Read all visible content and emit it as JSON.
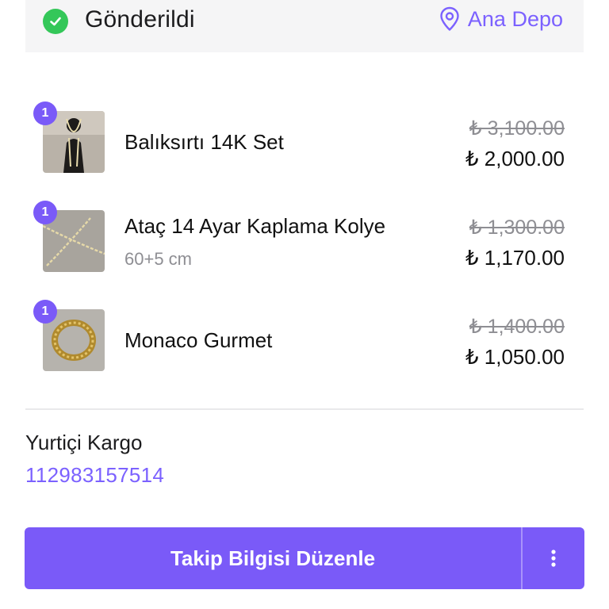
{
  "header": {
    "status_label": "Gönderildi",
    "status_color": "#34c759",
    "location_label": "Ana Depo",
    "accent_color": "#7b61ff"
  },
  "items": [
    {
      "qty": "1",
      "name": "Balıksırtı 14K Set",
      "variant": "",
      "old_price": "₺ 3,100.00",
      "new_price": "₺ 2,000.00"
    },
    {
      "qty": "1",
      "name": "Ataç 14 Ayar Kaplama Kolye",
      "variant": "60+5 cm",
      "old_price": "₺ 1,300.00",
      "new_price": "₺ 1,170.00"
    },
    {
      "qty": "1",
      "name": "Monaco Gurmet",
      "variant": "",
      "old_price": "₺ 1,400.00",
      "new_price": "₺ 1,050.00"
    }
  ],
  "shipping": {
    "carrier": "Yurtiçi Kargo",
    "tracking_number": "112983157514"
  },
  "actions": {
    "edit_tracking_label": "Takip Bilgisi Düzenle",
    "more_icon": "vertical-ellipsis-icon"
  }
}
